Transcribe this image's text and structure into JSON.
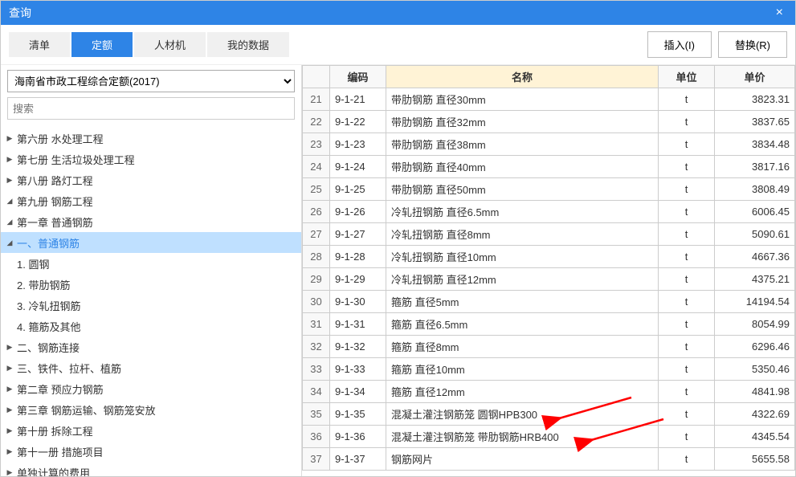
{
  "window": {
    "title": "查询",
    "close": "×"
  },
  "tabs": [
    {
      "label": "清单"
    },
    {
      "label": "定额",
      "active": true
    },
    {
      "label": "人材机"
    },
    {
      "label": "我的数据"
    }
  ],
  "buttons": {
    "insert": "插入(I)",
    "replace": "替换(R)"
  },
  "dropdown": {
    "selected": "海南省市政工程综合定额(2017)"
  },
  "search": {
    "placeholder": "搜索"
  },
  "tree": [
    {
      "level": 0,
      "state": "collapsed",
      "label": "第六册 水处理工程"
    },
    {
      "level": 0,
      "state": "collapsed",
      "label": "第七册 生活垃圾处理工程"
    },
    {
      "level": 0,
      "state": "collapsed",
      "label": "第八册 路灯工程"
    },
    {
      "level": 0,
      "state": "expanded",
      "label": "第九册 钢筋工程"
    },
    {
      "level": 1,
      "state": "expanded",
      "label": "第一章 普通钢筋"
    },
    {
      "level": 2,
      "state": "expanded",
      "label": "一、普通钢筋",
      "selected": true
    },
    {
      "level": 3,
      "state": "leaf",
      "label": "1. 圆钢"
    },
    {
      "level": 3,
      "state": "leaf",
      "label": "2. 带肋钢筋"
    },
    {
      "level": 3,
      "state": "leaf",
      "label": "3. 冷轧扭钢筋"
    },
    {
      "level": 3,
      "state": "leaf",
      "label": "4. 箍筋及其他"
    },
    {
      "level": 2,
      "state": "collapsed",
      "label": "二、钢筋连接"
    },
    {
      "level": 2,
      "state": "collapsed",
      "label": "三、铁件、拉杆、植筋"
    },
    {
      "level": 1,
      "state": "collapsed",
      "label": "第二章 预应力钢筋"
    },
    {
      "level": 1,
      "state": "collapsed",
      "label": "第三章 钢筋运输、钢筋笼安放"
    },
    {
      "level": 0,
      "state": "collapsed",
      "label": "第十册 拆除工程"
    },
    {
      "level": 0,
      "state": "collapsed",
      "label": "第十一册 措施项目"
    },
    {
      "level": 0,
      "state": "collapsed",
      "label": "单独计算的费用"
    }
  ],
  "columns": {
    "code": "编码",
    "name": "名称",
    "unit": "单位",
    "price": "单价"
  },
  "rows": [
    {
      "n": 21,
      "code": "9-1-21",
      "name": "带肋钢筋 直径30mm",
      "unit": "t",
      "price": "3823.31"
    },
    {
      "n": 22,
      "code": "9-1-22",
      "name": "带肋钢筋 直径32mm",
      "unit": "t",
      "price": "3837.65"
    },
    {
      "n": 23,
      "code": "9-1-23",
      "name": "带肋钢筋 直径38mm",
      "unit": "t",
      "price": "3834.48"
    },
    {
      "n": 24,
      "code": "9-1-24",
      "name": "带肋钢筋 直径40mm",
      "unit": "t",
      "price": "3817.16"
    },
    {
      "n": 25,
      "code": "9-1-25",
      "name": "带肋钢筋 直径50mm",
      "unit": "t",
      "price": "3808.49"
    },
    {
      "n": 26,
      "code": "9-1-26",
      "name": "冷轧扭钢筋 直径6.5mm",
      "unit": "t",
      "price": "6006.45"
    },
    {
      "n": 27,
      "code": "9-1-27",
      "name": "冷轧扭钢筋 直径8mm",
      "unit": "t",
      "price": "5090.61"
    },
    {
      "n": 28,
      "code": "9-1-28",
      "name": "冷轧扭钢筋 直径10mm",
      "unit": "t",
      "price": "4667.36"
    },
    {
      "n": 29,
      "code": "9-1-29",
      "name": "冷轧扭钢筋 直径12mm",
      "unit": "t",
      "price": "4375.21"
    },
    {
      "n": 30,
      "code": "9-1-30",
      "name": "箍筋 直径5mm",
      "unit": "t",
      "price": "14194.54"
    },
    {
      "n": 31,
      "code": "9-1-31",
      "name": "箍筋 直径6.5mm",
      "unit": "t",
      "price": "8054.99"
    },
    {
      "n": 32,
      "code": "9-1-32",
      "name": "箍筋 直径8mm",
      "unit": "t",
      "price": "6296.46"
    },
    {
      "n": 33,
      "code": "9-1-33",
      "name": "箍筋 直径10mm",
      "unit": "t",
      "price": "5350.46"
    },
    {
      "n": 34,
      "code": "9-1-34",
      "name": "箍筋 直径12mm",
      "unit": "t",
      "price": "4841.98"
    },
    {
      "n": 35,
      "code": "9-1-35",
      "name": "混凝土灌注钢筋笼 圆钢HPB300",
      "unit": "t",
      "price": "4322.69"
    },
    {
      "n": 36,
      "code": "9-1-36",
      "name": "混凝土灌注钢筋笼 带肋钢筋HRB400",
      "unit": "t",
      "price": "4345.54"
    },
    {
      "n": 37,
      "code": "9-1-37",
      "name": "钢筋网片",
      "unit": "t",
      "price": "5655.58"
    }
  ]
}
